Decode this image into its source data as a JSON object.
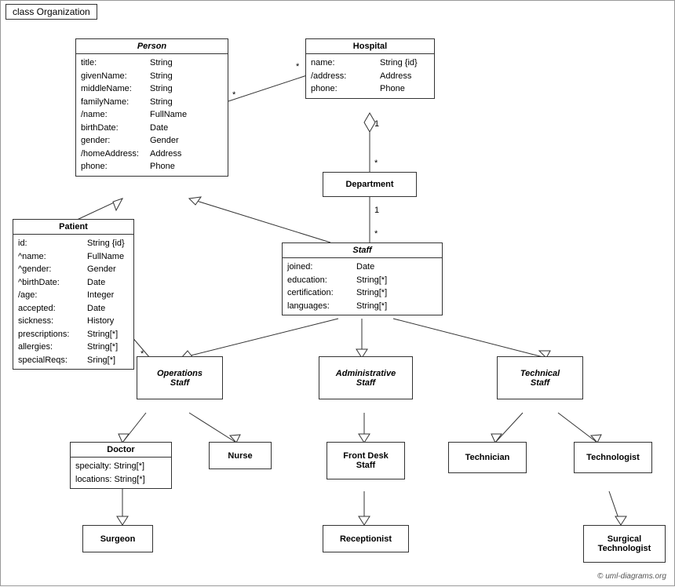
{
  "title": "class Organization",
  "classes": {
    "person": {
      "name": "Person",
      "italic": true,
      "attrs": [
        {
          "name": "title:",
          "type": "String"
        },
        {
          "name": "givenName:",
          "type": "String"
        },
        {
          "name": "middleName:",
          "type": "String"
        },
        {
          "name": "familyName:",
          "type": "String"
        },
        {
          "name": "/name:",
          "type": "FullName"
        },
        {
          "name": "birthDate:",
          "type": "Date"
        },
        {
          "name": "gender:",
          "type": "Gender"
        },
        {
          "name": "/homeAddress:",
          "type": "Address"
        },
        {
          "name": "phone:",
          "type": "Phone"
        }
      ]
    },
    "hospital": {
      "name": "Hospital",
      "italic": false,
      "attrs": [
        {
          "name": "name:",
          "type": "String {id}"
        },
        {
          "name": "/address:",
          "type": "Address"
        },
        {
          "name": "phone:",
          "type": "Phone"
        }
      ]
    },
    "patient": {
      "name": "Patient",
      "italic": false,
      "attrs": [
        {
          "name": "id:",
          "type": "String {id}"
        },
        {
          "name": "^name:",
          "type": "FullName"
        },
        {
          "name": "^gender:",
          "type": "Gender"
        },
        {
          "name": "^birthDate:",
          "type": "Date"
        },
        {
          "name": "/age:",
          "type": "Integer"
        },
        {
          "name": "accepted:",
          "type": "Date"
        },
        {
          "name": "sickness:",
          "type": "History"
        },
        {
          "name": "prescriptions:",
          "type": "String[*]"
        },
        {
          "name": "allergies:",
          "type": "String[*]"
        },
        {
          "name": "specialReqs:",
          "type": "Sring[*]"
        }
      ]
    },
    "department": {
      "name": "Department",
      "italic": false
    },
    "staff": {
      "name": "Staff",
      "italic": true,
      "attrs": [
        {
          "name": "joined:",
          "type": "Date"
        },
        {
          "name": "education:",
          "type": "String[*]"
        },
        {
          "name": "certification:",
          "type": "String[*]"
        },
        {
          "name": "languages:",
          "type": "String[*]"
        }
      ]
    },
    "operations_staff": {
      "name": "Operations\nStaff",
      "italic": true
    },
    "admin_staff": {
      "name": "Administrative\nStaff",
      "italic": true
    },
    "technical_staff": {
      "name": "Technical\nStaff",
      "italic": true
    },
    "doctor": {
      "name": "Doctor",
      "italic": false,
      "attrs": [
        {
          "name": "specialty:",
          "type": "String[*]"
        },
        {
          "name": "locations:",
          "type": "String[*]"
        }
      ]
    },
    "nurse": {
      "name": "Nurse",
      "italic": false
    },
    "front_desk": {
      "name": "Front Desk\nStaff",
      "italic": false
    },
    "technician": {
      "name": "Technician",
      "italic": false
    },
    "technologist": {
      "name": "Technologist",
      "italic": false
    },
    "surgeon": {
      "name": "Surgeon",
      "italic": false
    },
    "receptionist": {
      "name": "Receptionist",
      "italic": false
    },
    "surgical_technologist": {
      "name": "Surgical\nTechnologist",
      "italic": false
    }
  },
  "copyright": "© uml-diagrams.org"
}
